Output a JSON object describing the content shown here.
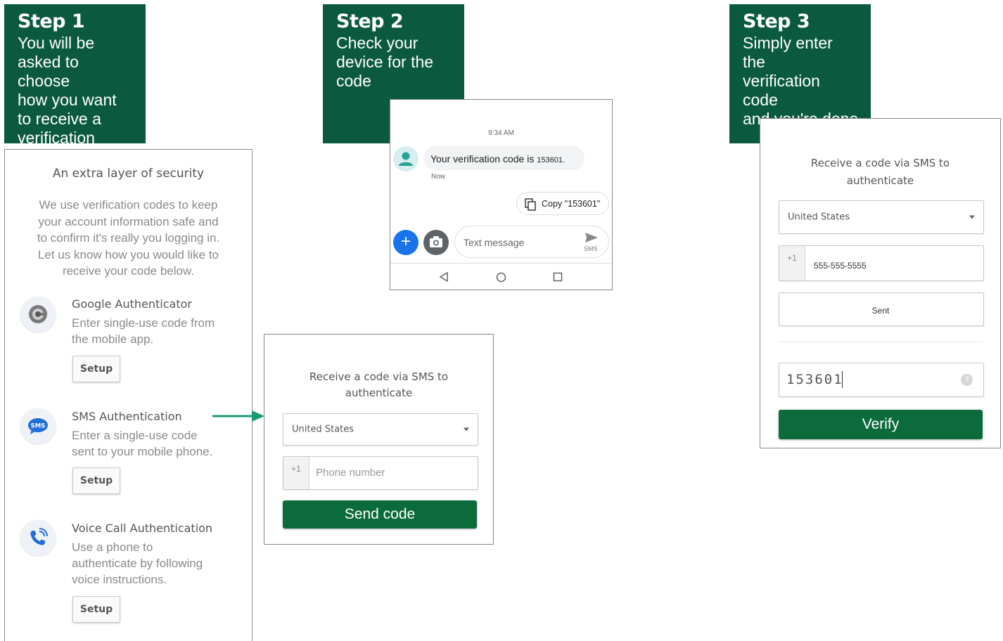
{
  "step1": {
    "title": "Step 1",
    "desc": "You will be\nasked to choose\nhow you want\nto receive a\nverification code"
  },
  "step2": {
    "title": "Step 2",
    "desc": "Check your\ndevice for the\ncode"
  },
  "step3": {
    "title": "Step 3",
    "desc": "Simply enter the\nverification code\nand you're done"
  },
  "security_panel": {
    "heading": "An extra layer of security",
    "intro": "We use verification codes to keep\nyour account information safe and\nto confirm it's really you logging in.\nLet us know how you would like to\nreceive your code below.",
    "methods": [
      {
        "title": "Google Authenticator",
        "desc": "Enter single-use code from\nthe mobile app.",
        "button": "Setup",
        "icon": "google-authenticator-icon"
      },
      {
        "title": "SMS Authentication",
        "desc": "Enter a single-use code\nsent to your mobile phone.",
        "button": "Setup",
        "icon": "sms-icon"
      },
      {
        "title": "Voice Call Authentication",
        "desc": "Use a phone to\nauthenticate by following\nvoice instructions.",
        "button": "Setup",
        "icon": "phone-call-icon"
      }
    ]
  },
  "sms_form": {
    "heading": "Receive a code via SMS to\nauthenticate",
    "country": "United States",
    "prefix": "+1",
    "phone_placeholder": "Phone number",
    "send_button": "Send code"
  },
  "phone_screen": {
    "time": "9:34 AM",
    "message_prefix": "Your verification code is ",
    "message_code": "153601.",
    "message_age": "Now",
    "copy_label": "Copy \"153601\"",
    "text_placeholder": "Text message",
    "send_label": "SMS"
  },
  "verify_form": {
    "heading": "Receive a code via SMS to\nauthenticate",
    "country": "United States",
    "prefix": "+1",
    "phone_value": "555-555-5555",
    "sent_label": "Sent",
    "code_value": "153601",
    "verify_button": "Verify"
  },
  "colors": {
    "brand_green": "#0b5a3f",
    "button_green": "#0b6b3a",
    "arrow_teal": "#1a9a78",
    "android_blue": "#1a73e8"
  }
}
